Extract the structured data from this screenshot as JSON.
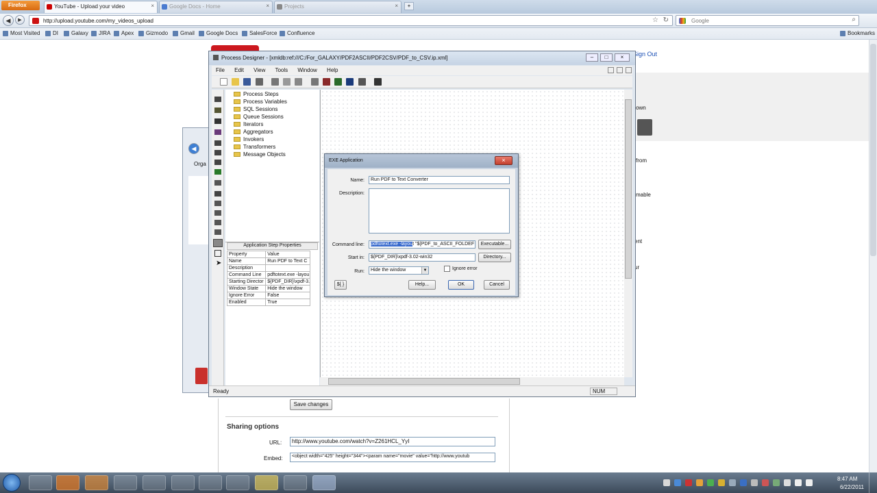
{
  "browser": {
    "menu_label": "Firefox",
    "tabs": [
      {
        "label": "YouTube - Upload your video",
        "active": true
      },
      {
        "label": "Google Docs - Home",
        "active": false
      },
      {
        "label": "Projects",
        "active": false
      }
    ],
    "url": "http://upload.youtube.com/my_videos_upload",
    "search_placeholder": "Google",
    "bookmarks": [
      "Most Visited",
      "DI",
      "Galaxy",
      "JIRA",
      "Apex",
      "Gizmodo",
      "Gmail",
      "Google Docs",
      "SalesForce",
      "Confluence"
    ],
    "bookmarks_menu": "Bookmarks"
  },
  "youtube_page": {
    "sign_out": "Sign Out",
    "right_fragments": [
      "own",
      "from",
      "mable",
      "ent",
      "ur"
    ],
    "save_changes": "Save changes",
    "sharing_options_title": "Sharing options",
    "url_label": "URL:",
    "url_value": "http://www.youtube.com/watch?v=Z261HCL_YyI",
    "embed_label": "Embed:",
    "embed_value": "<object width=\"425\" height=\"344\"><param name=\"movie\" value=\"http://www.youtub"
  },
  "explorer_fragments": {
    "organize": "Orga"
  },
  "process_designer": {
    "title": "Process Designer - [xmldb:ref:///C:/For_GALAXY/PDF2ASCII/PDF2CSV/PDF_to_CSV.ip.xml]",
    "menu": [
      "File",
      "Edit",
      "View",
      "Tools",
      "Window",
      "Help"
    ],
    "tree_items": [
      "Process Steps",
      "Process Variables",
      "SQL Sessions",
      "Queue Sessions",
      "Iterators",
      "Aggregators",
      "Invokers",
      "Transformers",
      "Message Objects"
    ],
    "properties_title": "Application Step Properties",
    "properties_headers": [
      "Property",
      "Value"
    ],
    "properties_rows": [
      [
        "Name",
        "Run PDF to Text C"
      ],
      [
        "Description",
        ""
      ],
      [
        "Command Line",
        "pdftotext.exe -layou"
      ],
      [
        "Starting Director",
        "${PDF_DIR}\\xpdf-3.0"
      ],
      [
        "Window State",
        "Hide the window"
      ],
      [
        "Ignore Error",
        "False"
      ],
      [
        "Enabled",
        "True"
      ]
    ],
    "status_ready": "Ready",
    "status_num": "NUM"
  },
  "exe_dialog": {
    "title": "EXE Application",
    "name_label": "Name:",
    "name_value": "Run PDF to Text Converter",
    "description_label": "Description:",
    "description_value": "",
    "command_label": "Command line:",
    "command_selected": "pdftotext.exe -layou",
    "command_rest": "t \"${PDF_to_ASCII_FOLDEF",
    "executable_button": "Executable...",
    "startin_label": "Start in:",
    "startin_value": "${PDF_DIR}\\xpdf-3.02-win32",
    "directory_button": "Directory...",
    "run_label": "Run:",
    "run_value": "Hide the window",
    "ignore_error_label": "Ignore error",
    "ignore_error_checked": false,
    "var_button": "${ }",
    "help_button": "Help...",
    "ok_button": "OK",
    "cancel_button": "Cancel"
  },
  "taskbar": {
    "time": "8:47 AM",
    "date": "6/22/2011"
  }
}
